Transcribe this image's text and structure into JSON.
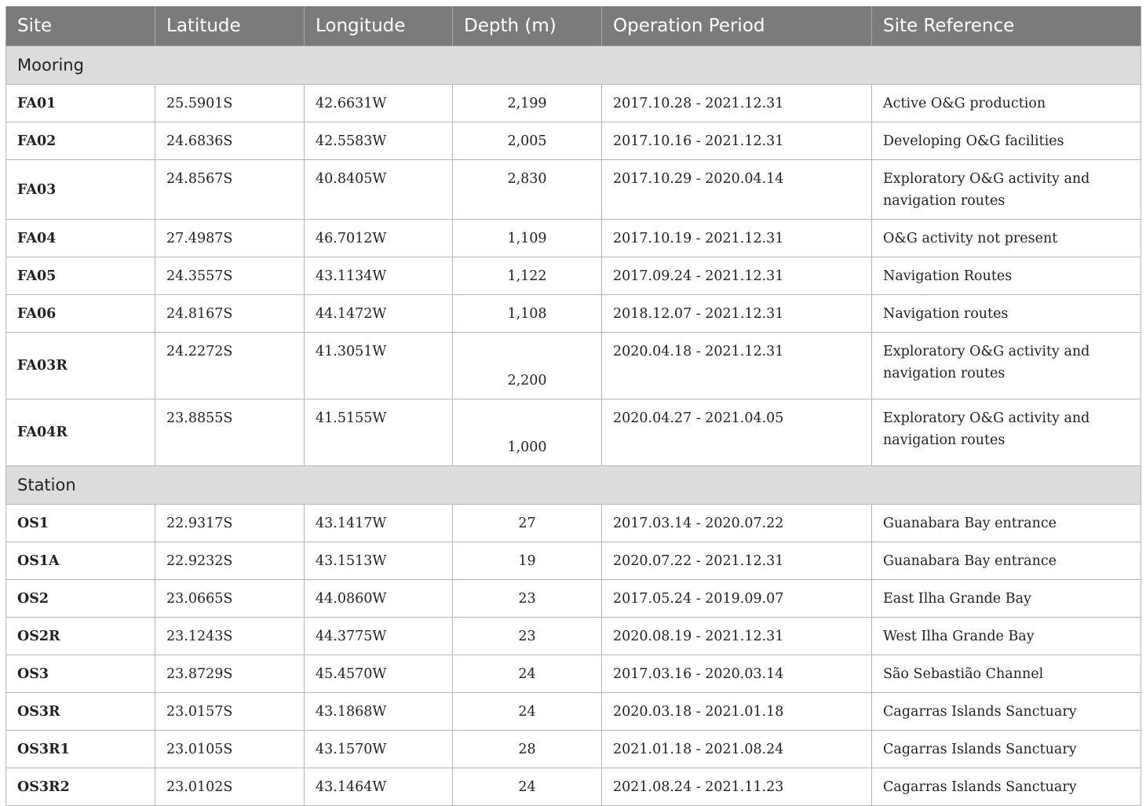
{
  "table": {
    "headers": [
      "Site",
      "Latitude",
      "Longitude",
      "Depth (m)",
      "Operation Period",
      "Site Reference"
    ],
    "groups": [
      {
        "label": "Mooring",
        "rows": [
          {
            "site": "FA01",
            "lat": "25.5901S",
            "lon": "42.6631W",
            "depth": "2,199",
            "period": "2017.10.28 - 2021.12.31",
            "ref": "Active O&G production"
          },
          {
            "site": "FA02",
            "lat": "24.6836S",
            "lon": "42.5583W",
            "depth": "2,005",
            "period": "2017.10.16 - 2021.12.31",
            "ref": "Developing O&G facilities"
          },
          {
            "site": "FA03",
            "lat": "24.8567S",
            "lon": "40.8405W",
            "depth": "2,830",
            "period": "2017.10.29 - 2020.04.14",
            "ref": "Exploratory O&G activity and navigation routes"
          },
          {
            "site": "FA04",
            "lat": "27.4987S",
            "lon": "46.7012W",
            "depth": "1,109",
            "period": "2017.10.19 - 2021.12.31",
            "ref": "O&G activity not present"
          },
          {
            "site": "FA05",
            "lat": "24.3557S",
            "lon": "43.1134W",
            "depth": "1,122",
            "period": "2017.09.24 - 2021.12.31",
            "ref": "Navigation Routes"
          },
          {
            "site": "FA06",
            "lat": "24.8167S",
            "lon": "44.1472W",
            "depth": "1,108",
            "period": "2018.12.07 - 2021.12.31",
            "ref": "Navigation routes"
          },
          {
            "site": "FA03R",
            "lat": "24.2272S",
            "lon": "41.3051W",
            "depth": "2,200",
            "period": "2020.04.18 - 2021.12.31",
            "ref": "Exploratory O&G activity and navigation routes"
          },
          {
            "site": "FA04R",
            "lat": "23.8855S",
            "lon": "41.5155W",
            "depth": "1,000",
            "period": "2020.04.27 - 2021.04.05",
            "ref": "Exploratory O&G activity and navigation routes"
          }
        ]
      },
      {
        "label": "Station",
        "rows": [
          {
            "site": "OS1",
            "lat": "22.9317S",
            "lon": "43.1417W",
            "depth": "27",
            "period": "2017.03.14 - 2020.07.22",
            "ref": "Guanabara Bay entrance"
          },
          {
            "site": "OS1A",
            "lat": "22.9232S",
            "lon": "43.1513W",
            "depth": "19",
            "period": "2020.07.22 - 2021.12.31",
            "ref": "Guanabara Bay entrance"
          },
          {
            "site": "OS2",
            "lat": "23.0665S",
            "lon": "44.0860W",
            "depth": "23",
            "period": "2017.05.24 - 2019.09.07",
            "ref": "East Ilha Grande Bay"
          },
          {
            "site": "OS2R",
            "lat": "23.1243S",
            "lon": "44.3775W",
            "depth": "23",
            "period": "2020.08.19 - 2021.12.31",
            "ref": "West Ilha Grande Bay"
          },
          {
            "site": "OS3",
            "lat": "23.8729S",
            "lon": "45.4570W",
            "depth": "24",
            "period": "2017.03.16 - 2020.03.14",
            "ref": "São Sebastião Channel"
          },
          {
            "site": "OS3R",
            "lat": "23.0157S",
            "lon": "43.1868W",
            "depth": "24",
            "period": "2020.03.18 - 2021.01.18",
            "ref": "Cagarras Islands Sanctuary"
          },
          {
            "site": "OS3R1",
            "lat": "23.0105S",
            "lon": "43.1570W",
            "depth": "28",
            "period": "2021.01.18 - 2021.08.24",
            "ref": "Cagarras Islands Sanctuary"
          },
          {
            "site": "OS3R2",
            "lat": "23.0102S",
            "lon": "43.1464W",
            "depth": "24",
            "period": "2021.08.24 - 2021.11.23",
            "ref": "Cagarras Islands Sanctuary"
          }
        ]
      }
    ]
  }
}
